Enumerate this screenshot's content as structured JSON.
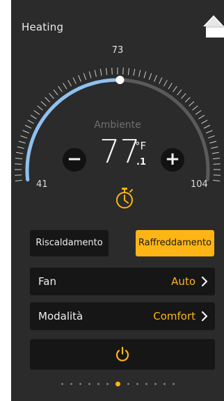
{
  "title": "Heating",
  "icons": {
    "home": "home-icon",
    "timer": "timer-icon",
    "power": "power-icon",
    "chevron": "chevron-right-icon"
  },
  "colors": {
    "accent": "#fdb515",
    "arc_active": "#8ec1f0",
    "arc_track": "#5a5a5a",
    "panel": "#2b2b2b"
  },
  "dial": {
    "setpoint": "73",
    "min": "41",
    "max": "104",
    "ambient_label": "Ambiente",
    "temperature_int": "77",
    "temperature_unit": "°F",
    "temperature_dec": ".1",
    "minus_label": "−",
    "plus_label": "+"
  },
  "modes": {
    "heat_label": "Riscaldamento",
    "cool_label": "Raffreddamento",
    "selected": "Raffreddamento"
  },
  "fan": {
    "label": "Fan",
    "value": "Auto"
  },
  "mode": {
    "label": "Modalità",
    "value": "Comfort"
  },
  "pagination": {
    "count": 13,
    "active_index": 6
  }
}
